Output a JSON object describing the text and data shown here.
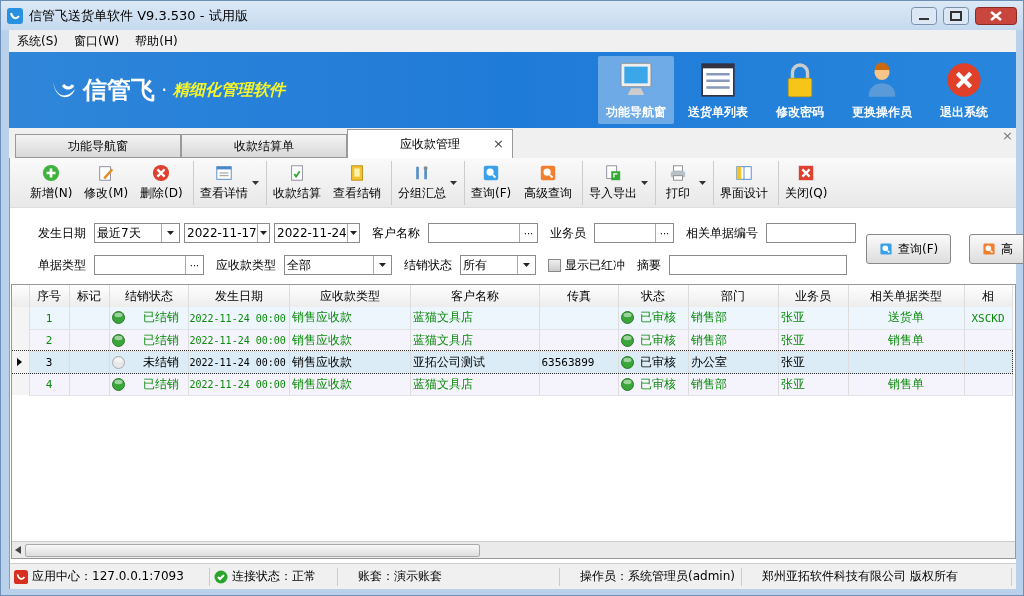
{
  "window": {
    "title": "信管飞送货单软件 V9.3.530 - 试用版"
  },
  "menu": [
    "系统(S)",
    "窗口(W)",
    "帮助(H)"
  ],
  "banner": {
    "brand": "信管飞",
    "dot": "·",
    "slogan": "精细化管理软件"
  },
  "nav_buttons": [
    {
      "label": "功能导航窗",
      "selected": true
    },
    {
      "label": "送货单列表",
      "selected": false
    },
    {
      "label": "修改密码",
      "selected": false
    },
    {
      "label": "更换操作员",
      "selected": false
    },
    {
      "label": "退出系统",
      "selected": false
    }
  ],
  "tabs": [
    {
      "label": "功能导航窗",
      "selected": false
    },
    {
      "label": "收款结算单",
      "selected": false
    },
    {
      "label": "应收款管理",
      "selected": true,
      "close": "×"
    }
  ],
  "panel_close": "×",
  "toolbar": [
    {
      "label": "新增(N)",
      "dropdown": false,
      "separator_before": false
    },
    {
      "label": "修改(M)",
      "dropdown": false,
      "separator_before": false
    },
    {
      "label": "删除(D)",
      "dropdown": false,
      "separator_before": false
    },
    {
      "label": "查看详情",
      "dropdown": true,
      "separator_before": true
    },
    {
      "label": "收款结算",
      "dropdown": false,
      "separator_before": true
    },
    {
      "label": "查看结销",
      "dropdown": false,
      "separator_before": false
    },
    {
      "label": "分组汇总",
      "dropdown": true,
      "separator_before": true
    },
    {
      "label": "查询(F)",
      "dropdown": false,
      "separator_before": true
    },
    {
      "label": "高级查询",
      "dropdown": false,
      "separator_before": false
    },
    {
      "label": "导入导出",
      "dropdown": true,
      "separator_before": true
    },
    {
      "label": "打印",
      "dropdown": true,
      "separator_before": true
    },
    {
      "label": "界面设计",
      "dropdown": false,
      "separator_before": true
    },
    {
      "label": "关闭(Q)",
      "dropdown": false,
      "separator_before": true
    }
  ],
  "filter_rows": [
    [
      {
        "kind": "label",
        "text": "发生日期"
      },
      {
        "kind": "select",
        "value": "最近7天"
      },
      {
        "kind": "select",
        "value": "2022-11-17"
      },
      {
        "kind": "select",
        "value": "2022-11-24"
      },
      {
        "kind": "label",
        "text": "客户名称"
      },
      {
        "kind": "picker",
        "button_text": "···"
      },
      {
        "kind": "label",
        "text": "业务员"
      },
      {
        "kind": "picker",
        "button_text": "···"
      },
      {
        "kind": "label",
        "text": "相关单据编号"
      },
      {
        "kind": "input"
      }
    ],
    [
      {
        "kind": "label",
        "text": "单据类型"
      },
      {
        "kind": "picker",
        "button_text": "···"
      },
      {
        "kind": "label",
        "text": "应收款类型"
      },
      {
        "kind": "select",
        "value": "全部"
      },
      {
        "kind": "label",
        "text": "结销状态"
      },
      {
        "kind": "select",
        "value": "所有"
      },
      {
        "kind": "checkbox",
        "label": "显示已红冲",
        "checked": false
      },
      {
        "kind": "label",
        "text": "摘要"
      },
      {
        "kind": "input"
      }
    ]
  ],
  "query_buttons": [
    "查询(F)",
    "高"
  ],
  "table": {
    "columns": [
      "序号",
      "标记",
      "结销状态",
      "发生日期",
      "应收款类型",
      "客户名称",
      "传真",
      "状态",
      "部门",
      "业务员",
      "相关单据类型",
      "相"
    ],
    "rows": [
      {
        "seq": "1",
        "settled": true,
        "selected": false,
        "settle_status": "已结销",
        "date": "2022-11-24 00:00",
        "receivable_type": "销售应收款",
        "customer": "蓝猫文具店",
        "status": "已审核",
        "department": "销售部",
        "salesperson": "张亚",
        "doc_type": "送货单",
        "column_12": "XSCKD"
      },
      {
        "seq": "2",
        "settled": true,
        "selected": false,
        "settle_status": "已结销",
        "date": "2022-11-24 00:00",
        "receivable_type": "销售应收款",
        "customer": "蓝猫文具店",
        "status": "已审核",
        "department": "销售部",
        "salesperson": "张亚",
        "doc_type": "销售单"
      },
      {
        "seq": "3",
        "settled": false,
        "selected": true,
        "settle_status": "未结销",
        "date": "2022-11-24 00:00",
        "receivable_type": "销售应收款",
        "customer": "亚拓公司测试",
        "fax": "63563899",
        "status": "已审核",
        "department": "办公室",
        "salesperson": "张亚"
      },
      {
        "seq": "4",
        "settled": true,
        "selected": false,
        "settle_status": "已结销",
        "date": "2022-11-24 00:00",
        "receivable_type": "销售应收款",
        "customer": "蓝猫文具店",
        "status": "已审核",
        "department": "销售部",
        "salesperson": "张亚",
        "doc_type": "销售单"
      }
    ]
  },
  "status_bar": [
    "应用中心：127.0.0.1:7093",
    "连接状态：正常",
    "账套：演示账套",
    "操作员：系统管理员(admin)",
    "郑州亚拓软件科技有限公司 版权所有"
  ]
}
